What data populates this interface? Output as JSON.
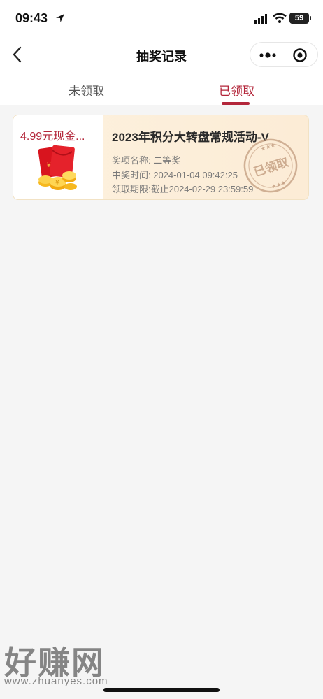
{
  "status_bar": {
    "time": "09:43",
    "battery": "59"
  },
  "nav": {
    "title": "抽奖记录"
  },
  "tabs": [
    {
      "label": "未领取",
      "active": false
    },
    {
      "label": "已领取",
      "active": true
    }
  ],
  "record": {
    "prize_name": "4.99元现金...",
    "activity_title": "2023年积分大转盘常规活动-V",
    "prize_level": "奖项名称: 二等奖",
    "win_time": "中奖时间: 2024-01-04 09:42:25",
    "claim_deadline": "领取期限:截止2024-02-29 23:59:59",
    "stamp": "已领取"
  },
  "watermark": {
    "name": "好赚网",
    "url": "www.zhuanyes.com"
  },
  "colors": {
    "accent": "#b3263a",
    "card_bg": "#fcecd6",
    "page_bg": "#f5f5f5"
  }
}
